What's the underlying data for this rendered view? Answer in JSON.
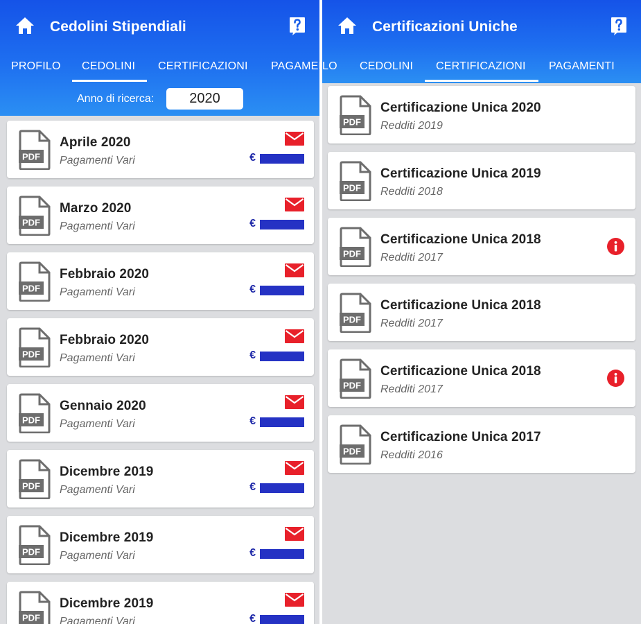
{
  "colors": {
    "header_top": "#1553e8",
    "header_bottom": "#2b8ff3",
    "mail_red": "#e8202a",
    "info_red": "#e8202a",
    "euro_blue": "#2532c4"
  },
  "left": {
    "title": "Cedolini Stipendiali",
    "tabs": [
      "PROFILO",
      "CEDOLINI",
      "CERTIFICAZIONI",
      "PAGAMENTI"
    ],
    "active_tab": "CEDOLINI",
    "year_label": "Anno di ricerca:",
    "year_value": "2020",
    "items": [
      {
        "title": "Aprile 2020",
        "subtitle": "Pagamenti Vari",
        "currency": "€"
      },
      {
        "title": "Marzo 2020",
        "subtitle": "Pagamenti Vari",
        "currency": "€"
      },
      {
        "title": "Febbraio 2020",
        "subtitle": "Pagamenti Vari",
        "currency": "€"
      },
      {
        "title": "Febbraio 2020",
        "subtitle": "Pagamenti Vari",
        "currency": "€"
      },
      {
        "title": "Gennaio 2020",
        "subtitle": "Pagamenti Vari",
        "currency": "€"
      },
      {
        "title": "Dicembre 2019",
        "subtitle": "Pagamenti Vari",
        "currency": "€"
      },
      {
        "title": "Dicembre 2019",
        "subtitle": "Pagamenti Vari",
        "currency": "€"
      },
      {
        "title": "Dicembre 2019",
        "subtitle": "Pagamenti Vari",
        "currency": "€"
      }
    ],
    "icons": {
      "home": "home-icon",
      "help": "help-icon",
      "file": "pdf-file-icon",
      "mail": "mail-icon"
    }
  },
  "right": {
    "title": "Certificazioni Uniche",
    "tabs": [
      "LO",
      "CEDOLINI",
      "CERTIFICAZIONI",
      "PAGAMENTI"
    ],
    "active_tab": "CERTIFICAZIONI",
    "items": [
      {
        "title": "Certificazione Unica 2020",
        "subtitle": "Redditi 2019",
        "info": false
      },
      {
        "title": "Certificazione Unica 2019",
        "subtitle": "Redditi 2018",
        "info": false
      },
      {
        "title": "Certificazione Unica 2018",
        "subtitle": "Redditi 2017",
        "info": true
      },
      {
        "title": "Certificazione Unica 2018",
        "subtitle": "Redditi 2017",
        "info": false
      },
      {
        "title": "Certificazione Unica 2018",
        "subtitle": "Redditi 2017",
        "info": true
      },
      {
        "title": "Certificazione Unica 2017",
        "subtitle": "Redditi 2016",
        "info": false
      }
    ],
    "icons": {
      "home": "home-icon",
      "help": "help-icon",
      "file": "pdf-file-icon",
      "info": "info-icon"
    }
  }
}
